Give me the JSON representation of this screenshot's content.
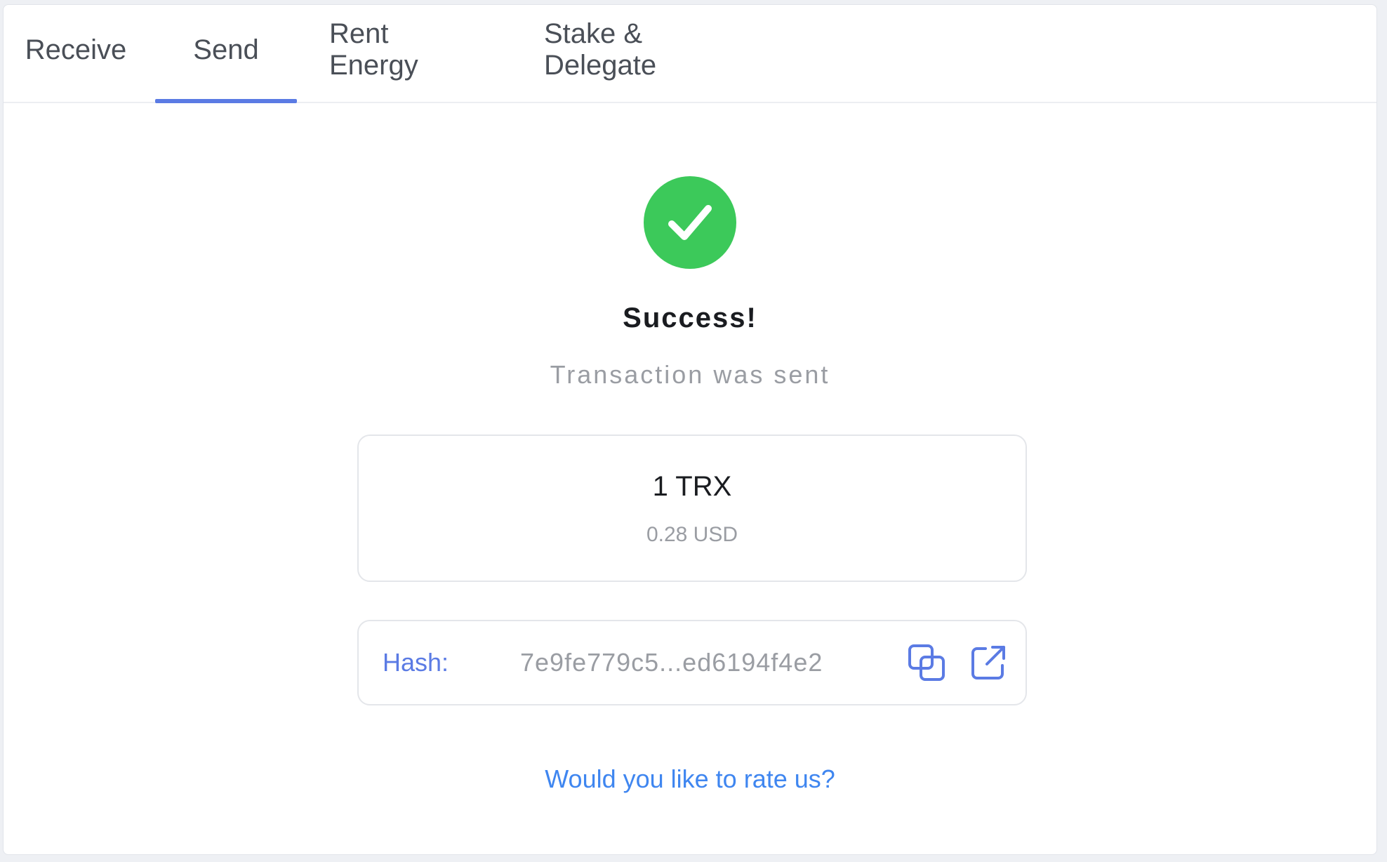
{
  "tabs": [
    {
      "label": "Receive"
    },
    {
      "label": "Send"
    },
    {
      "label": "Rent Energy"
    },
    {
      "label": "Stake & Delegate"
    }
  ],
  "active_tab": "Send",
  "status": {
    "title": "Success!",
    "subtitle": "Transaction was sent",
    "icon": "check-circle-icon",
    "color": "#3cc95a"
  },
  "amount": {
    "value": "1 TRX",
    "fiat": "0.28 USD"
  },
  "hash": {
    "label": "Hash:",
    "value": "7e9fe779c5...ed6194f4e2",
    "copy_icon": "copy-icon",
    "open_icon": "external-link-icon"
  },
  "rate_link": "Would you like to rate us?",
  "colors": {
    "accent": "#5b7be4",
    "link": "#3f86f0"
  }
}
